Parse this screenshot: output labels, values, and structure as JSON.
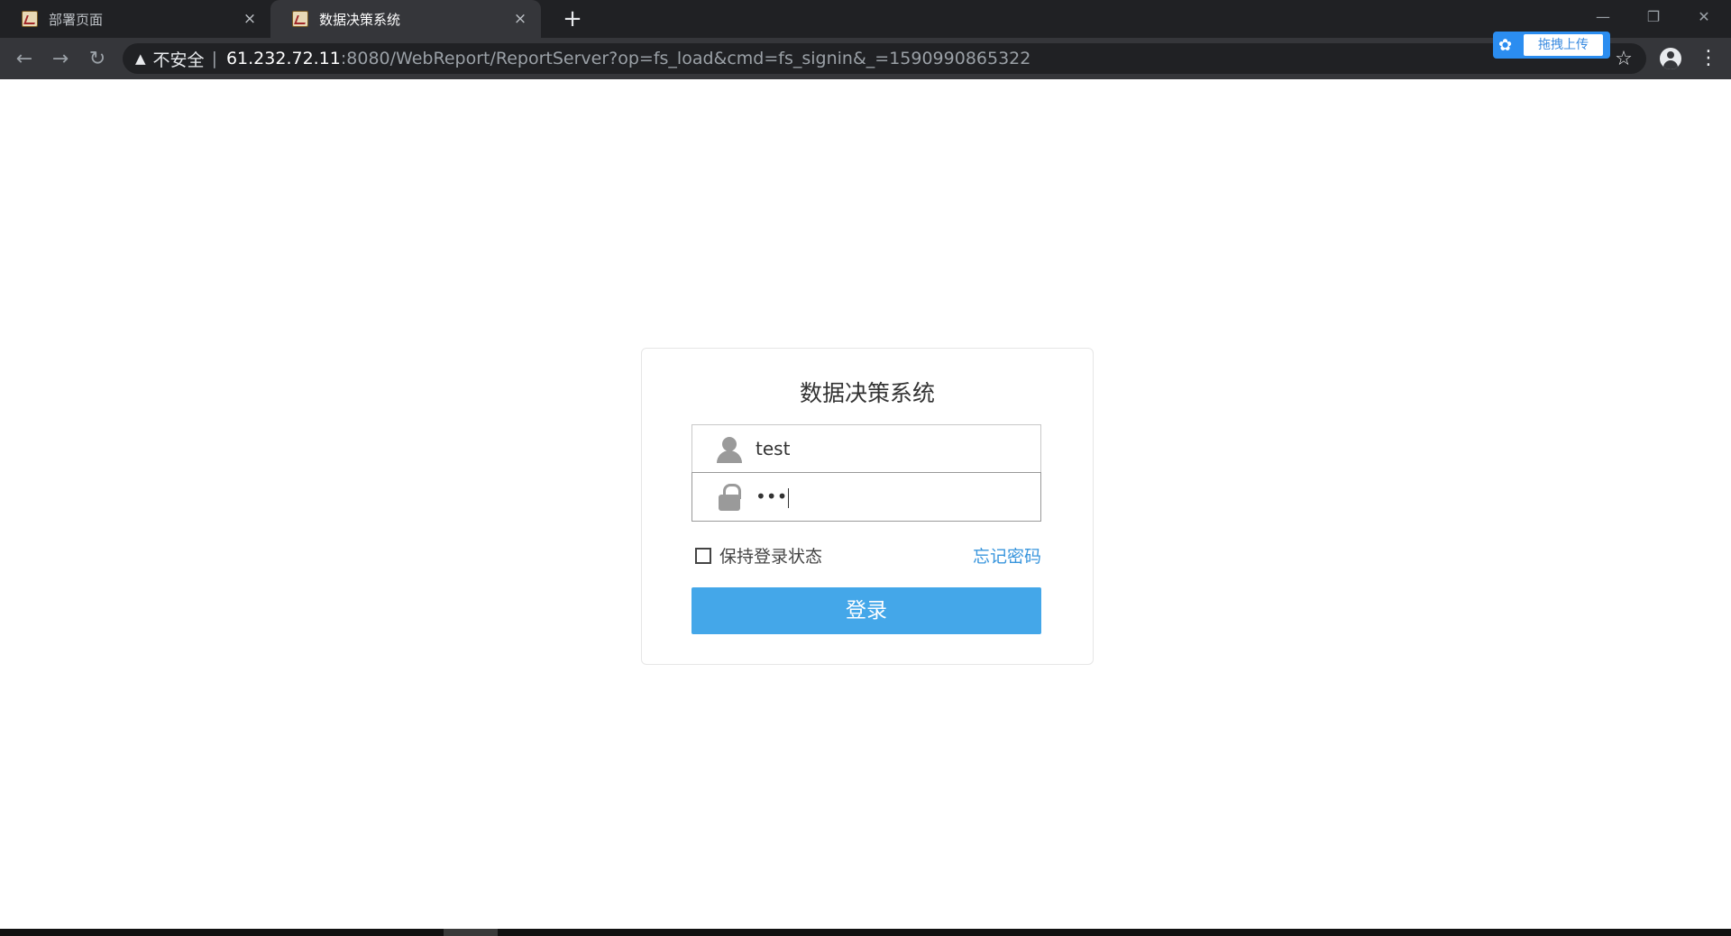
{
  "browser": {
    "tabs": [
      {
        "title": "部署页面",
        "close": "×",
        "active": false
      },
      {
        "title": "数据决策系统",
        "close": "×",
        "active": true
      }
    ],
    "new_tab": "+",
    "window_controls": {
      "minimize": "—",
      "restore": "❐",
      "close": "✕"
    },
    "nav": {
      "back": "←",
      "forward": "→",
      "reload": "↻"
    },
    "address": {
      "security_warning": "▲",
      "security_label": "不安全",
      "separator": "|",
      "host": "61.232.72.11",
      "rest": ":8080/WebReport/ReportServer?op=fs_load&cmd=fs_signin&_=1590990865322"
    },
    "extension": {
      "icon": "✿",
      "label": "拖拽上传"
    },
    "bookmark_icon": "☆",
    "menu_icon": "⋮"
  },
  "login": {
    "title": "数据决策系统",
    "username": "test",
    "password_masked": "•••",
    "remember_label": "保持登录状态",
    "remember_checked": false,
    "forgot_label": "忘记密码",
    "submit_label": "登录"
  },
  "colors": {
    "accent": "#44a7e9",
    "link": "#3a96dd",
    "chrome_dark": "#202124",
    "chrome_toolbar": "#35363a"
  }
}
